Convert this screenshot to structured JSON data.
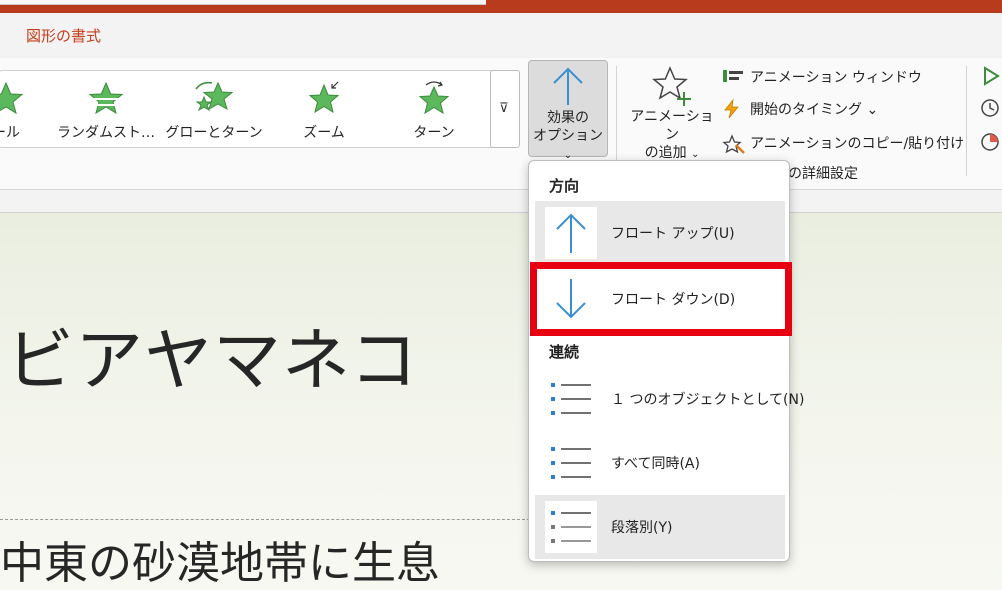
{
  "tabs": {
    "active_tab": "図形の書式"
  },
  "gallery": {
    "items": [
      {
        "label": "ール"
      },
      {
        "label": "ランダムスト…"
      },
      {
        "label": "グローとターン"
      },
      {
        "label": "ズーム"
      },
      {
        "label": "ターン"
      }
    ],
    "scroll_glyph": "⊽"
  },
  "effect_options": {
    "line1": "効果の",
    "line2": "オプション",
    "chevron": "⌄"
  },
  "add_animation": {
    "line1": "アニメーション",
    "line2": "の追加",
    "chevron": "⌄"
  },
  "advanced": {
    "pane": "アニメーション ウィンドウ",
    "trigger": "開始のタイミング ⌄",
    "painter": "アニメーションのコピー/貼り付け",
    "detail": "の詳細設定"
  },
  "slide": {
    "title": "ビアヤマネコ",
    "subtitle": "中東の砂漠地帯に生息"
  },
  "menu": {
    "section_direction": "方向",
    "float_up": "フロート アップ(U)",
    "float_down": "フロート ダウン(D)",
    "section_sequence": "連続",
    "as_one_object": "１ つのオブジェクトとして(N)",
    "all_at_once": "すべて同時(A)",
    "by_paragraph": "段落別(Y)"
  },
  "colors": {
    "accent_red": "#c43e1c",
    "highlight": "#e60012",
    "star_green": "#5cb85c",
    "arrow_blue": "#3b8fd1"
  }
}
